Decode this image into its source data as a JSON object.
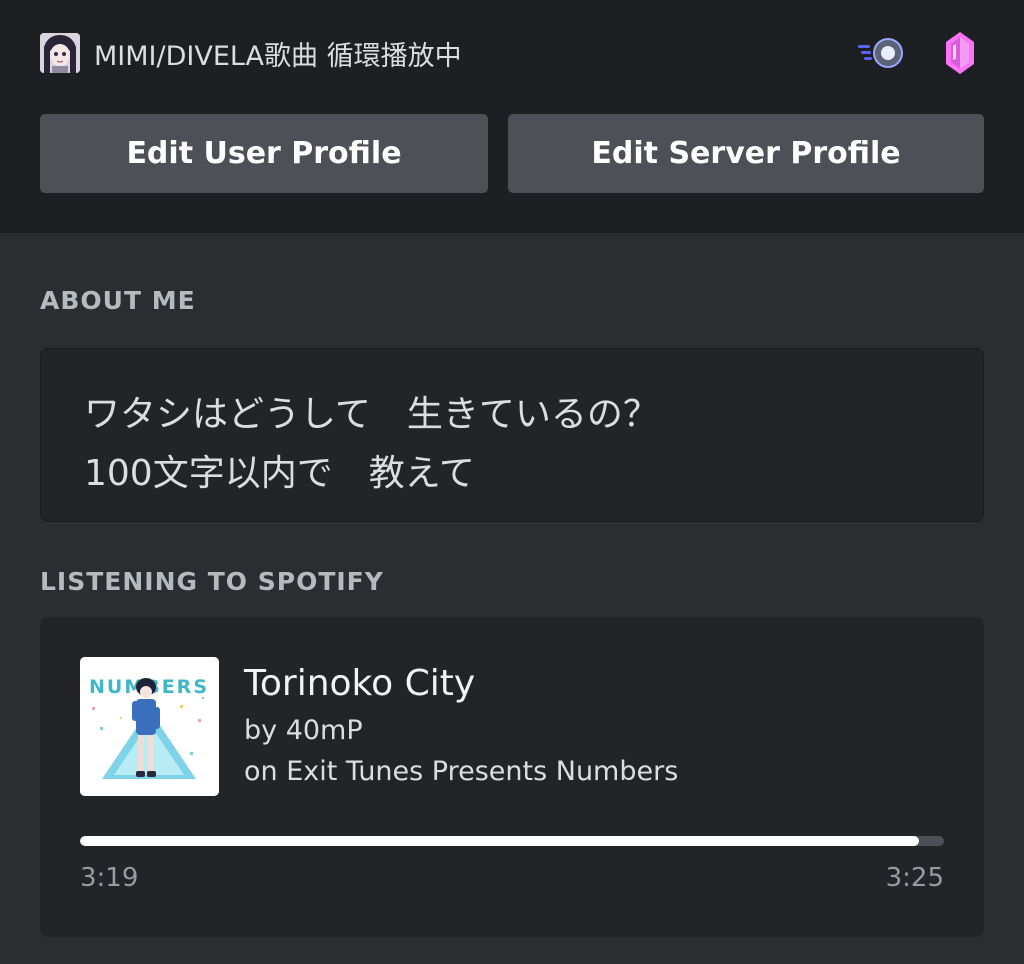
{
  "header": {
    "custom_status": "MIMI/DIVELA歌曲 循環播放中",
    "badges": [
      "nitro-icon",
      "server-boost-gem-icon"
    ]
  },
  "buttons": {
    "edit_user_profile": "Edit User Profile",
    "edit_server_profile": "Edit Server Profile"
  },
  "about_me": {
    "title": "ABOUT ME",
    "line1": "ワタシはどうして　生きているの？",
    "line2": "100文字以内で　教えて"
  },
  "spotify": {
    "title": "LISTENING TO SPOTIFY",
    "track": "Torinoko City",
    "artist": "by 40mP",
    "album": "on Exit Tunes Presents Numbers",
    "album_art_text": "NUMBERS",
    "elapsed": "3:19",
    "duration": "3:25",
    "progress": 0.971
  },
  "colors": {
    "background": "#2b2d31",
    "header_bg": "#1e1f22",
    "button": "#4e5058",
    "card": "#232428",
    "nitro_blue": "#5865f2",
    "gem_pink": "#ff73fa"
  }
}
